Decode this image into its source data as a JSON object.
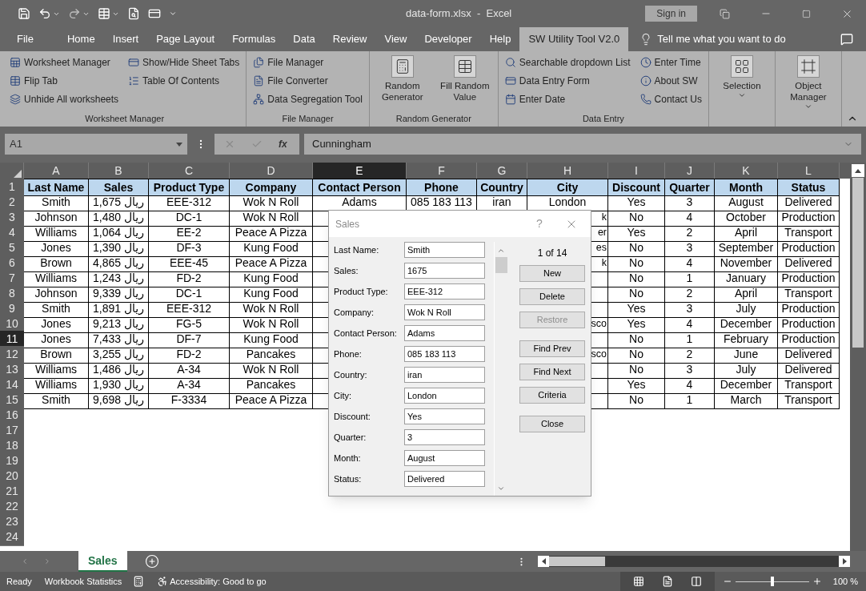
{
  "title_bar": {
    "title": "data-form.xlsx  -  Excel",
    "sign_in": "Sign in"
  },
  "menu_tabs": [
    {
      "label": "File",
      "selected": false
    },
    {
      "label": "Home",
      "selected": false
    },
    {
      "label": "Insert",
      "selected": false
    },
    {
      "label": "Page Layout",
      "selected": false
    },
    {
      "label": "Formulas",
      "selected": false
    },
    {
      "label": "Data",
      "selected": false
    },
    {
      "label": "Review",
      "selected": false
    },
    {
      "label": "View",
      "selected": false
    },
    {
      "label": "Developer",
      "selected": false
    },
    {
      "label": "Help",
      "selected": false
    },
    {
      "label": "SW Utility Tool V2.0",
      "selected": true
    }
  ],
  "tell_me": "Tell me what you want to do",
  "ribbon": {
    "groups": [
      {
        "kind": "small",
        "columns": [
          [
            {
              "label": "Worksheet Manager"
            },
            {
              "label": "Flip Tab"
            },
            {
              "label": "Unhide All worksheets"
            }
          ],
          [
            {
              "label": "Show/Hide Sheet Tabs"
            },
            {
              "label": "Table Of Contents"
            }
          ]
        ],
        "label": "Worksheet Manager"
      },
      {
        "kind": "small",
        "columns": [
          [
            {
              "label": "File Manager"
            },
            {
              "label": "File Converter"
            },
            {
              "label": "Data Segregation Tool"
            }
          ]
        ],
        "label": "File Manager"
      },
      {
        "kind": "large",
        "items": [
          {
            "label": "Random Generator"
          },
          {
            "label": "Fill Random Value"
          }
        ],
        "label": "Random Generator"
      },
      {
        "kind": "small",
        "columns": [
          [
            {
              "label": "Searchable dropdown List"
            },
            {
              "label": "Data Entry Form"
            },
            {
              "label": "Enter Date"
            }
          ],
          [
            {
              "label": "Enter Time"
            },
            {
              "label": "About SW"
            },
            {
              "label": "Contact Us"
            }
          ]
        ],
        "label": "Data Entry"
      },
      {
        "kind": "large",
        "items": [
          {
            "label": "Selection",
            "dropdown": true
          }
        ]
      },
      {
        "kind": "large",
        "items": [
          {
            "label": "Object Manager",
            "dropdown": true
          }
        ]
      }
    ]
  },
  "formula_bar": {
    "name_box": "A1",
    "fx": "fx",
    "value": "Cunningham"
  },
  "grid": {
    "columns": [
      {
        "letter": "A",
        "selected": false
      },
      {
        "letter": "B",
        "selected": false
      },
      {
        "letter": "C",
        "selected": false
      },
      {
        "letter": "D",
        "selected": false
      },
      {
        "letter": "E",
        "selected": true
      },
      {
        "letter": "F",
        "selected": false
      },
      {
        "letter": "G",
        "selected": false
      },
      {
        "letter": "H",
        "selected": false
      },
      {
        "letter": "I",
        "selected": false
      },
      {
        "letter": "J",
        "selected": false
      },
      {
        "letter": "K",
        "selected": false
      },
      {
        "letter": "L",
        "selected": false
      }
    ],
    "rows": [
      {
        "number": "1",
        "selected": false,
        "kind": "header",
        "cells": {
          "A": "Last Name",
          "B": "Sales",
          "C": "Product Type",
          "D": "Company",
          "E": "Contact Person",
          "F": "Phone",
          "G": "Country",
          "H": "City",
          "I": "Discount",
          "J": "Quarter",
          "K": "Month",
          "L": "Status"
        }
      },
      {
        "number": "2",
        "selected": false,
        "kind": "data",
        "cells": {
          "A": "Smith",
          "B": "1,675 ريال",
          "C": "EEE-312",
          "D": "Wok N Roll",
          "E": "Adams",
          "F": "085 183 113",
          "G": "iran",
          "H": "London",
          "I": "Yes",
          "J": "3",
          "K": "August",
          "L": "Delivered"
        }
      },
      {
        "number": "3",
        "selected": false,
        "kind": "data",
        "cells": {
          "A": "Johnson",
          "B": "1,480 ريال",
          "C": "DC-1",
          "D": "Wok N Roll",
          "H": "k",
          "I": "No",
          "J": "4",
          "K": "October",
          "L": "Production"
        }
      },
      {
        "number": "4",
        "selected": false,
        "kind": "data",
        "cells": {
          "A": "Williams",
          "B": "1,064 ريال",
          "C": "EE-2",
          "D": "Peace A Pizza",
          "H": "er",
          "I": "Yes",
          "J": "2",
          "K": "April",
          "L": "Transport"
        }
      },
      {
        "number": "5",
        "selected": false,
        "kind": "data",
        "cells": {
          "A": "Jones",
          "B": "1,390 ريال",
          "C": "DF-3",
          "D": "Kung Food",
          "H": "es",
          "I": "No",
          "J": "3",
          "K": "September",
          "L": "Production"
        }
      },
      {
        "number": "6",
        "selected": false,
        "kind": "data",
        "cells": {
          "A": "Brown",
          "B": "4,865 ريال",
          "C": "EEE-45",
          "D": "Peace A Pizza",
          "H": "k",
          "I": "No",
          "J": "4",
          "K": "November",
          "L": "Delivered"
        }
      },
      {
        "number": "7",
        "selected": false,
        "kind": "data",
        "cells": {
          "A": "Williams",
          "B": "1,243 ريال",
          "C": "FD-2",
          "D": "Kung Food",
          "I": "No",
          "J": "1",
          "K": "January",
          "L": "Production"
        }
      },
      {
        "number": "8",
        "selected": false,
        "kind": "data",
        "cells": {
          "A": "Johnson",
          "B": "9,339 ريال",
          "C": "DC-1",
          "D": "Kung Food",
          "I": "No",
          "J": "2",
          "K": "April",
          "L": "Transport"
        }
      },
      {
        "number": "9",
        "selected": false,
        "kind": "data",
        "cells": {
          "A": "Smith",
          "B": "1,891 ريال",
          "C": "EEE-312",
          "D": "Wok N Roll",
          "I": "Yes",
          "J": "3",
          "K": "July",
          "L": "Production"
        }
      },
      {
        "number": "10",
        "selected": false,
        "kind": "data",
        "cells": {
          "A": "Jones",
          "B": "9,213 ريال",
          "C": "FG-5",
          "D": "Wok N Roll",
          "H": "sco",
          "I": "Yes",
          "J": "4",
          "K": "December",
          "L": "Production"
        }
      },
      {
        "number": "11",
        "selected": true,
        "kind": "data",
        "cells": {
          "A": "Jones",
          "B": "7,433 ريال",
          "C": "DF-7",
          "D": "Kung Food",
          "I": "No",
          "J": "1",
          "K": "February",
          "L": "Production"
        }
      },
      {
        "number": "12",
        "selected": false,
        "kind": "data",
        "cells": {
          "A": "Brown",
          "B": "3,255 ريال",
          "C": "FD-2",
          "D": "Pancakes",
          "H": "sco",
          "I": "No",
          "J": "2",
          "K": "June",
          "L": "Delivered"
        }
      },
      {
        "number": "13",
        "selected": false,
        "kind": "data",
        "cells": {
          "A": "Williams",
          "B": "1,486 ريال",
          "C": "A-34",
          "D": "Wok N Roll",
          "I": "No",
          "J": "3",
          "K": "July",
          "L": "Delivered"
        }
      },
      {
        "number": "14",
        "selected": false,
        "kind": "data",
        "cells": {
          "A": "Williams",
          "B": "1,930 ريال",
          "C": "A-34",
          "D": "Pancakes",
          "I": "Yes",
          "J": "4",
          "K": "December",
          "L": "Transport"
        }
      },
      {
        "number": "15",
        "selected": false,
        "kind": "data",
        "cells": {
          "A": "Smith",
          "B": "9,698 ريال",
          "C": "F-3334",
          "D": "Peace A Pizza",
          "I": "No",
          "J": "1",
          "K": "March",
          "L": "Transport"
        }
      },
      {
        "number": "16",
        "selected": false,
        "kind": "empty"
      },
      {
        "number": "17",
        "selected": false,
        "kind": "empty"
      },
      {
        "number": "18",
        "selected": false,
        "kind": "empty"
      },
      {
        "number": "19",
        "selected": false,
        "kind": "empty"
      },
      {
        "number": "20",
        "selected": false,
        "kind": "empty"
      },
      {
        "number": "21",
        "selected": false,
        "kind": "empty"
      },
      {
        "number": "22",
        "selected": false,
        "kind": "empty"
      },
      {
        "number": "23",
        "selected": false,
        "kind": "empty"
      },
      {
        "number": "24",
        "selected": false,
        "kind": "empty"
      }
    ]
  },
  "data_form": {
    "title": "Sales",
    "help": "?",
    "counter": "1 of 14",
    "fields": [
      {
        "label": "Last Name:",
        "value": "Smith"
      },
      {
        "label": "Sales:",
        "value": "1675"
      },
      {
        "label": "Product Type:",
        "value": "EEE-312"
      },
      {
        "label": "Company:",
        "value": "Wok N Roll"
      },
      {
        "label": "Contact Person:",
        "value": "Adams"
      },
      {
        "label": "Phone:",
        "value": "085 183 113"
      },
      {
        "label": "Country:",
        "value": "iran"
      },
      {
        "label": "City:",
        "value": "London"
      },
      {
        "label": "Discount:",
        "value": "Yes"
      },
      {
        "label": "Quarter:",
        "value": "3"
      },
      {
        "label": "Month:",
        "value": "August"
      },
      {
        "label": "Status:",
        "value": "Delivered"
      }
    ],
    "buttons": [
      {
        "label": "New",
        "disabled": false
      },
      {
        "label": "Delete",
        "disabled": false
      },
      {
        "label": "Restore",
        "disabled": true
      },
      {
        "label": "Find Prev",
        "disabled": false
      },
      {
        "label": "Find Next",
        "disabled": false
      },
      {
        "label": "Criteria",
        "disabled": false
      },
      {
        "label": "Close",
        "disabled": false
      }
    ]
  },
  "sheet_tabs": [
    {
      "label": "Sales",
      "selected": true
    }
  ],
  "status_bar": {
    "ready": "Ready",
    "workbook_statistics": "Workbook Statistics",
    "accessibility": "Accessibility: Good to go",
    "zoom": {
      "level": 0.5,
      "reading": "100 %"
    }
  }
}
